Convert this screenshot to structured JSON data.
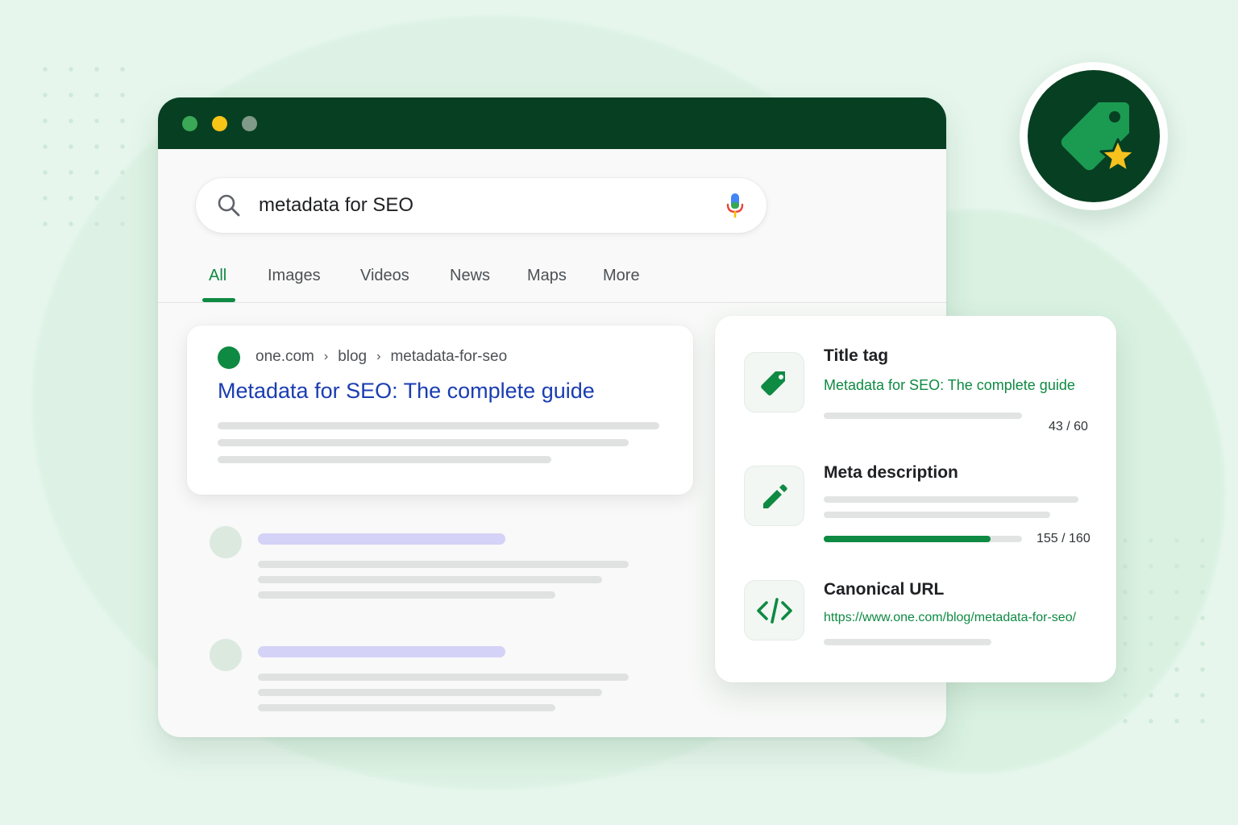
{
  "search": {
    "query": "metadata for SEO"
  },
  "tabs": [
    {
      "label": "All",
      "active": true
    },
    {
      "label": "Images",
      "active": false
    },
    {
      "label": "Videos",
      "active": false
    },
    {
      "label": "News",
      "active": false
    },
    {
      "label": "Maps",
      "active": false
    },
    {
      "label": "More",
      "active": false
    }
  ],
  "result": {
    "breadcrumb": [
      "one.com",
      "blog",
      "metadata-for-seo"
    ],
    "separator": "›",
    "title": "Metadata for SEO: The complete guide"
  },
  "panel": {
    "title_tag": {
      "heading": "Title tag",
      "value": "Metadata for SEO: The complete guide",
      "count": "43 / 60",
      "icon": "tag-icon"
    },
    "meta_description": {
      "heading": "Meta description",
      "count": "155 / 160",
      "progress_fraction": 0.84,
      "icon": "pencil-icon"
    },
    "canonical_url": {
      "heading": "Canonical URL",
      "value": "https://www.one.com/blog/metadata-for-seo/",
      "icon": "code-icon"
    }
  },
  "badge": {
    "icon": "tag-star-icon"
  },
  "colors": {
    "brand_dark": "#073f22",
    "brand_green": "#0e8a43",
    "link_blue": "#1a3db0",
    "traffic_green": "#3aa856",
    "traffic_yellow": "#f5c518",
    "traffic_gray": "#7f9a89",
    "star_yellow": "#f7c21d"
  }
}
